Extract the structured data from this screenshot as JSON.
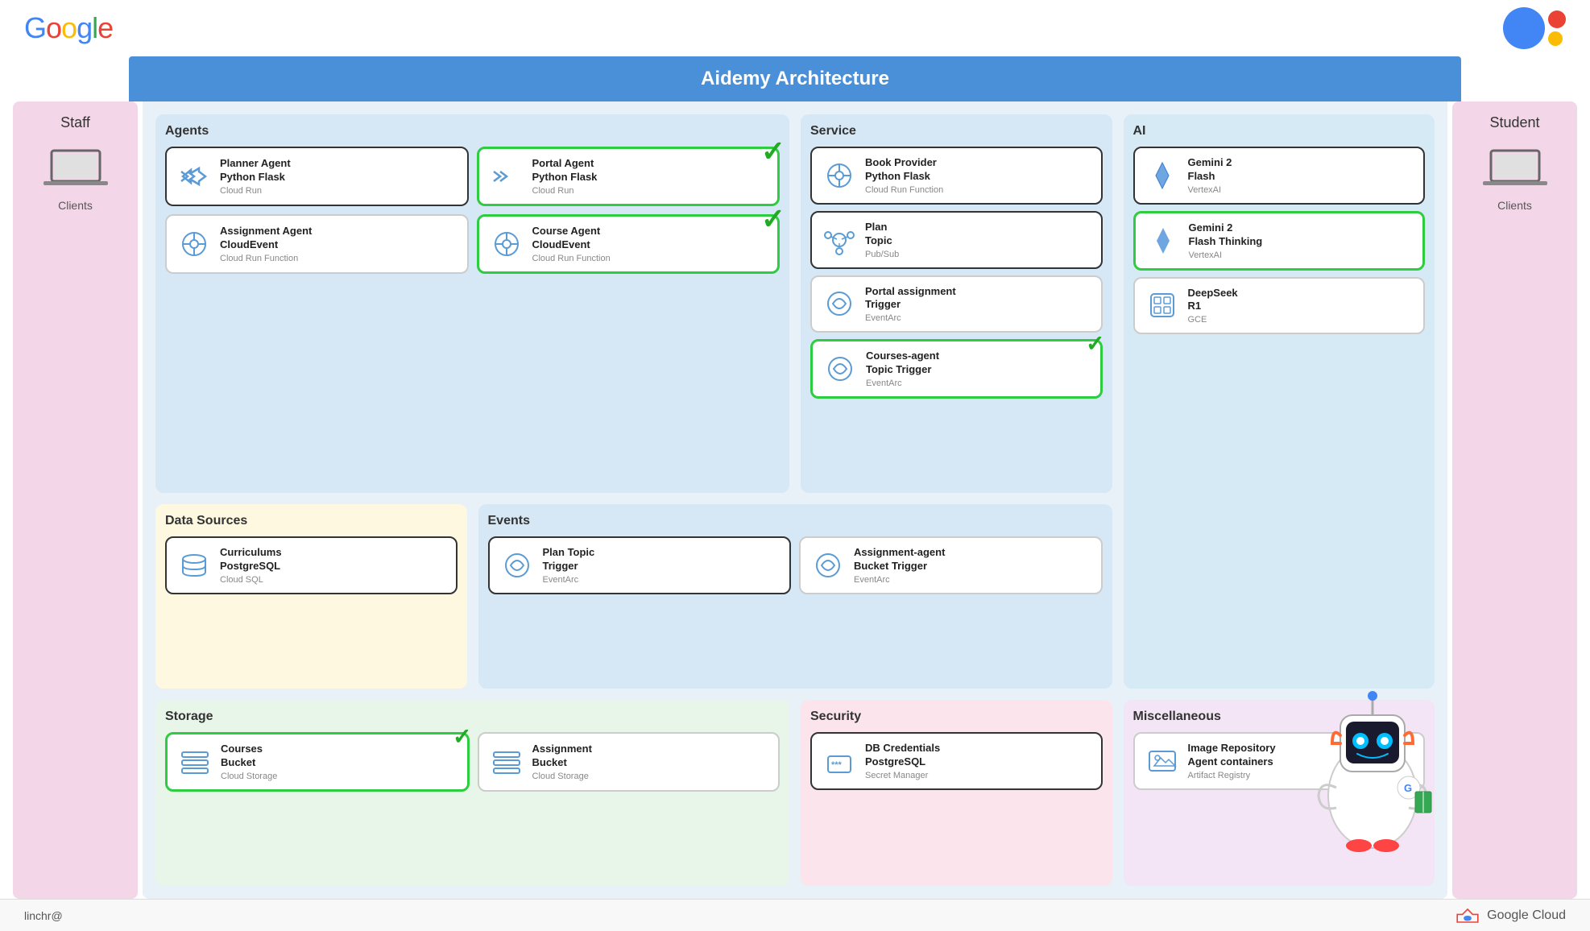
{
  "header": {
    "title": "Aidemy Architecture",
    "google_logo": "Google",
    "bottom_user": "linchr@",
    "google_cloud": "Google Cloud"
  },
  "left_panel": {
    "title": "Staff",
    "label": "Clients"
  },
  "right_panel": {
    "title": "Student",
    "label": "Clients"
  },
  "sections": {
    "agents": {
      "title": "Agents",
      "cards": [
        {
          "id": "planner-agent",
          "title": "Planner Agent\nPython Flask",
          "subtitle": "Cloud Run",
          "border": "dark",
          "checkmark": false
        },
        {
          "id": "portal-agent",
          "title": "Portal Agent\nPython Flask",
          "subtitle": "Cloud Run",
          "border": "green",
          "checkmark": true
        },
        {
          "id": "assignment-agent",
          "title": "Assignment Agent\nCloudEvent",
          "subtitle": "Cloud Run Function",
          "border": "normal",
          "checkmark": false
        },
        {
          "id": "course-agent",
          "title": "Course Agent\nCloudEvent",
          "subtitle": "Cloud Run Function",
          "border": "green",
          "checkmark": true
        }
      ]
    },
    "service": {
      "title": "Service",
      "cards": [
        {
          "id": "book-provider",
          "title": "Book Provider\nPython Flask",
          "subtitle": "Cloud Run Function",
          "border": "dark",
          "checkmark": false
        },
        {
          "id": "plan-topic",
          "title": "Plan\nTopic",
          "subtitle": "Pub/Sub",
          "border": "dark",
          "checkmark": false
        },
        {
          "id": "portal-trigger",
          "title": "Portal assignment\nTrigger",
          "subtitle": "EventArc",
          "border": "normal",
          "checkmark": false
        },
        {
          "id": "courses-agent-trigger",
          "title": "Courses-agent\nTopic Trigger",
          "subtitle": "EventArc",
          "border": "green",
          "checkmark": true
        }
      ]
    },
    "ai": {
      "title": "AI",
      "cards": [
        {
          "id": "gemini-flash",
          "title": "Gemini 2\nFlash",
          "subtitle": "VertexAI",
          "border": "dark"
        },
        {
          "id": "gemini-thinking",
          "title": "Gemini 2\nFlash Thinking",
          "subtitle": "VertexAI",
          "border": "green"
        },
        {
          "id": "deepseek",
          "title": "DeepSeek\nR1",
          "subtitle": "GCE",
          "border": "normal"
        }
      ]
    },
    "data_sources": {
      "title": "Data Sources",
      "cards": [
        {
          "id": "curriculums",
          "title": "Curriculums\nPostgreSQL",
          "subtitle": "Cloud SQL",
          "border": "dark"
        }
      ]
    },
    "events": {
      "title": "Events",
      "cards": [
        {
          "id": "plan-topic-trigger",
          "title": "Plan Topic\nTrigger",
          "subtitle": "EventArc",
          "border": "dark"
        },
        {
          "id": "assignment-bucket-trigger",
          "title": "Assignment-agent\nBucket Trigger",
          "subtitle": "EventArc",
          "border": "normal"
        }
      ]
    },
    "storage": {
      "title": "Storage",
      "cards": [
        {
          "id": "courses-bucket",
          "title": "Courses\nBucket",
          "subtitle": "Cloud Storage",
          "border": "green",
          "checkmark": true
        },
        {
          "id": "assignment-bucket",
          "title": "Assignment\nBucket",
          "subtitle": "Cloud Storage",
          "border": "normal"
        }
      ]
    },
    "security": {
      "title": "Security",
      "cards": [
        {
          "id": "db-credentials",
          "title": "DB Credentials\nPostgreSQL",
          "subtitle": "Secret Manager",
          "border": "dark"
        }
      ]
    },
    "misc": {
      "title": "Miscellaneous",
      "cards": [
        {
          "id": "image-repo",
          "title": "Image Repository\nAgent containers",
          "subtitle": "Artifact Registry",
          "border": "normal"
        }
      ]
    }
  }
}
